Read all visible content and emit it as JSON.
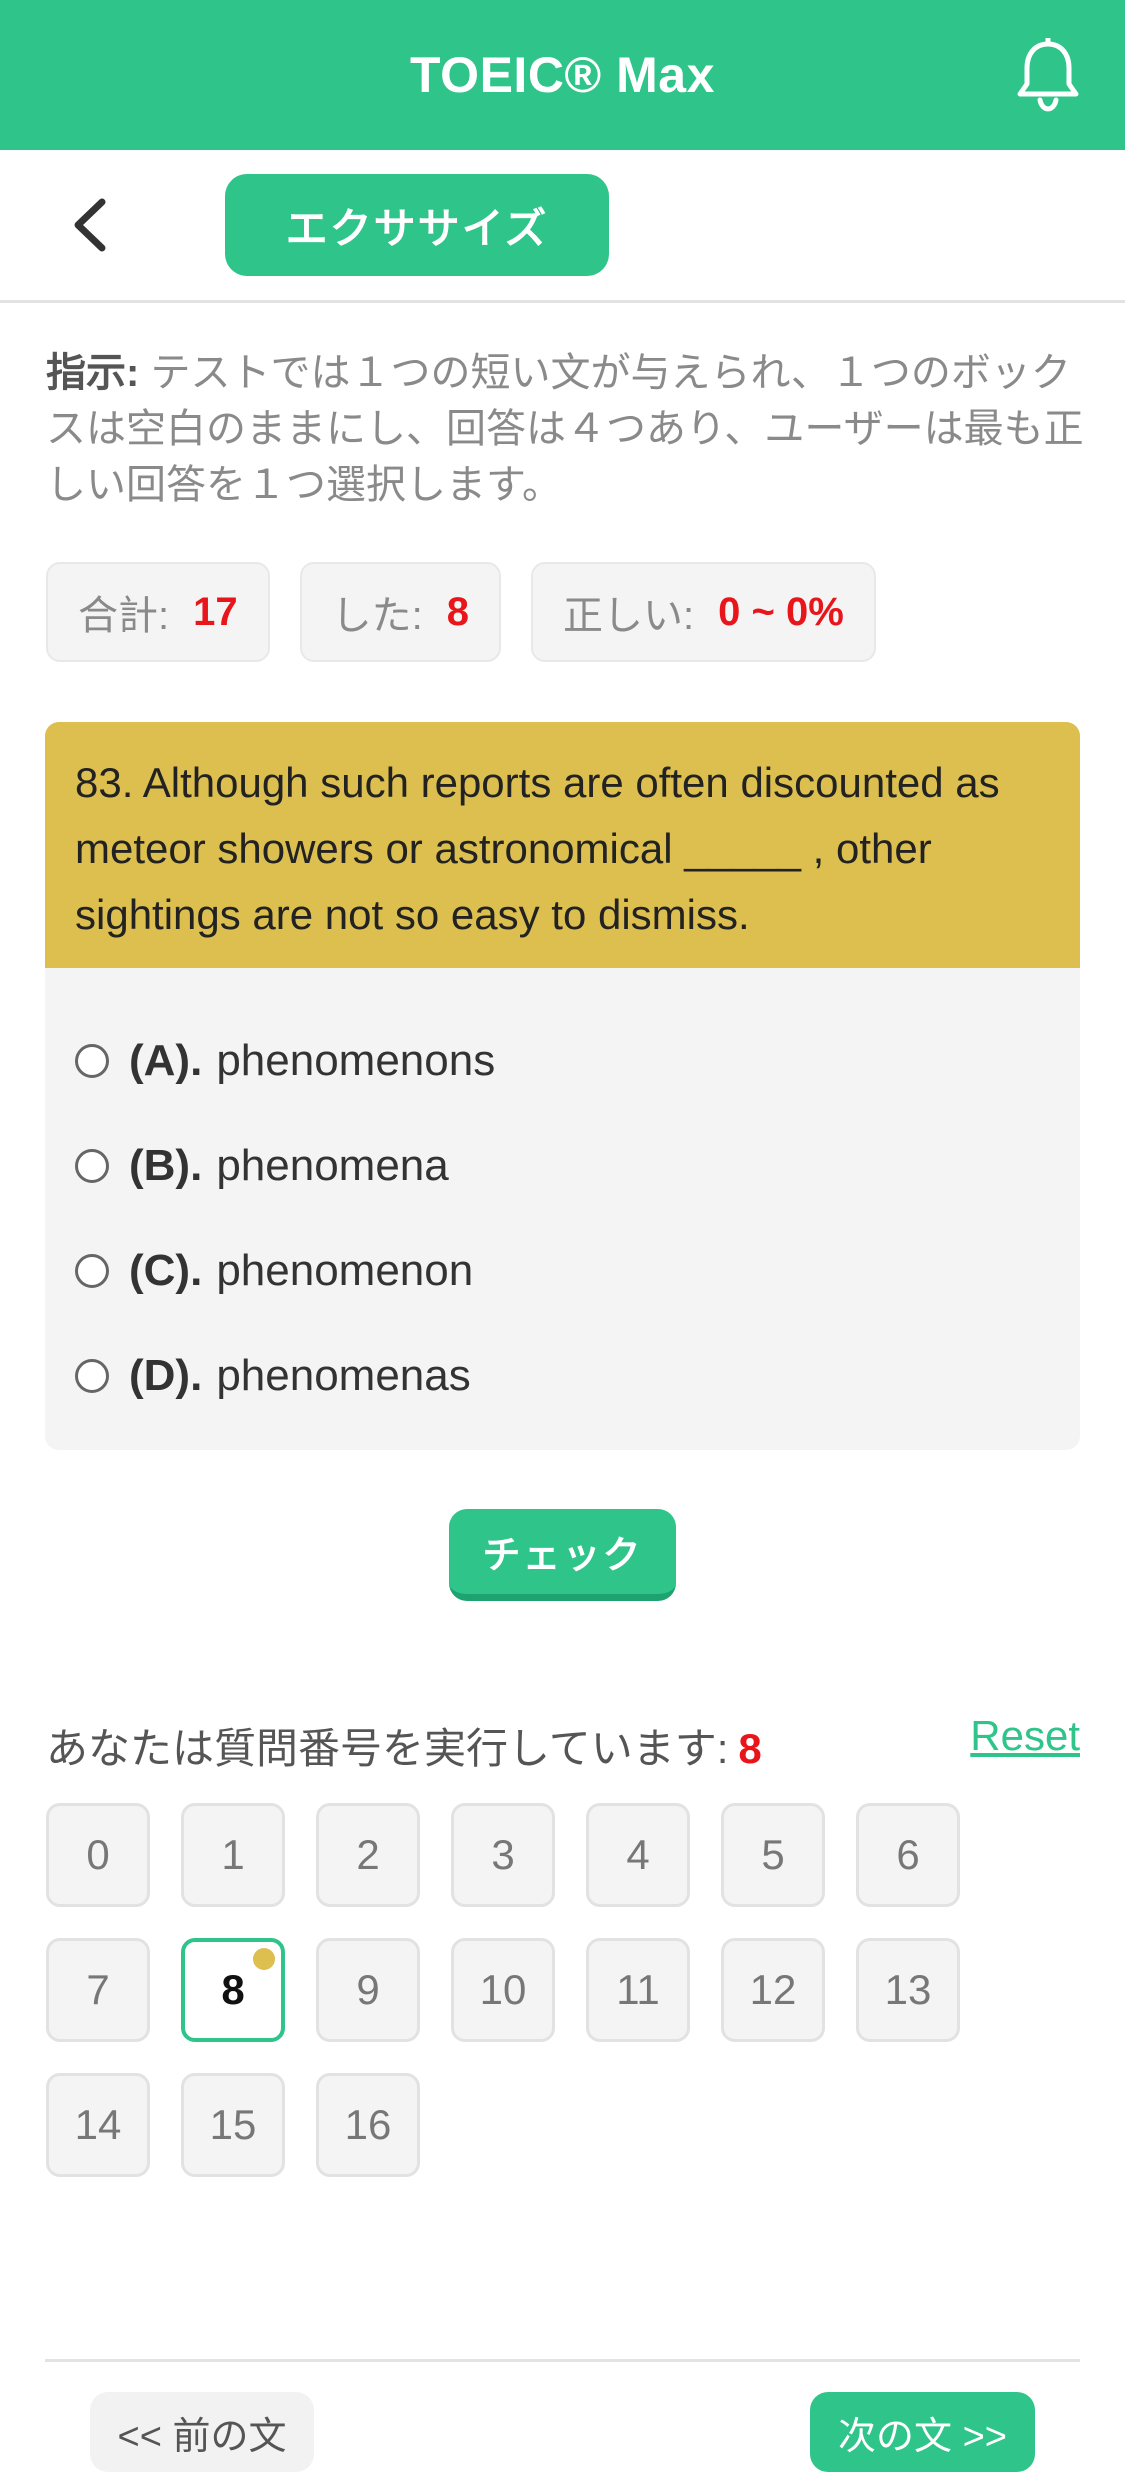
{
  "header": {
    "app_title": "TOEIC® Max",
    "icons": {
      "notifications": "bell-icon",
      "back": "chevron-left-icon"
    }
  },
  "subheader": {
    "tab_label": "エクササイズ"
  },
  "instruction": {
    "label": "指示:",
    "text": " テストでは１つの短い文が与えられ、１つのボックスは空白のままにし、回答は４つあり、ユーザーは最も正しい回答を１つ選択します。"
  },
  "stats": [
    {
      "label": "合計:",
      "value": "17"
    },
    {
      "label": "した:",
      "value": "8"
    },
    {
      "label": "正しい:",
      "value": "0 ~ 0%"
    }
  ],
  "question": {
    "text": "83. Although such reports are often discounted as meteor showers or astronomical _____ , other sightings are not so easy to dismiss.",
    "options": [
      {
        "letter": "(A).",
        "text": "phenomenons"
      },
      {
        "letter": "(B).",
        "text": "phenomena"
      },
      {
        "letter": "(C).",
        "text": "phenomenon"
      },
      {
        "letter": "(D).",
        "text": "phenomenas"
      }
    ]
  },
  "check_button": "チェック",
  "progress": {
    "label": "あなたは質問番号を実行しています:",
    "current": "8",
    "reset": "Reset"
  },
  "question_numbers": [
    "0",
    "1",
    "2",
    "3",
    "4",
    "5",
    "6",
    "7",
    "8",
    "9",
    "10",
    "11",
    "12",
    "13",
    "14",
    "15",
    "16"
  ],
  "nav": {
    "prev": "<< 前の文",
    "next": "次の文 >>"
  },
  "colors": {
    "primary": "#2ec48a",
    "question_bg": "#dcbf4f",
    "highlight_red": "#e8151b"
  }
}
